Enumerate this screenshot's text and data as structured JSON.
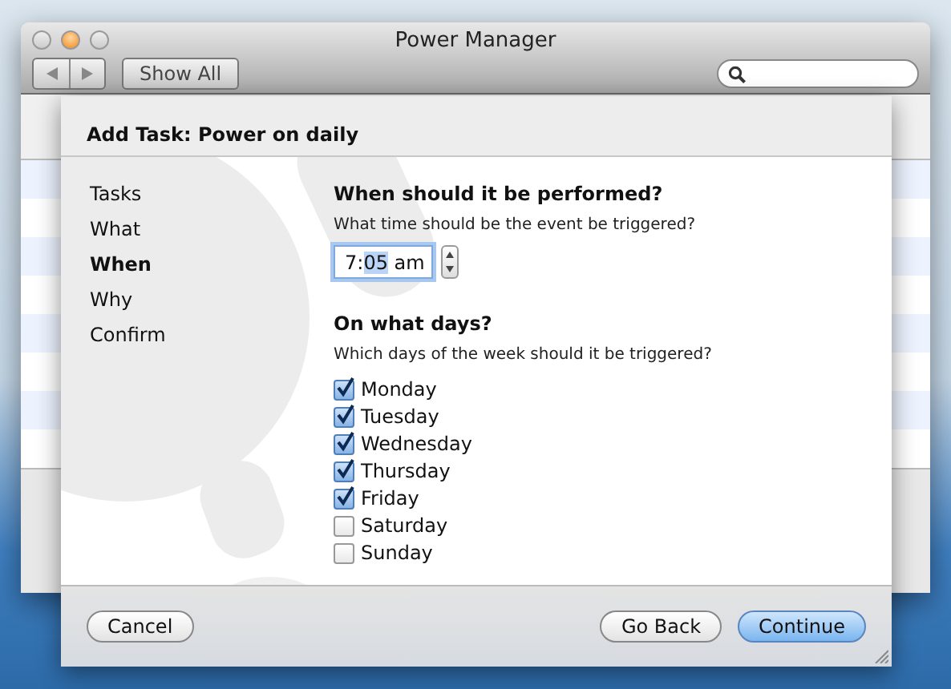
{
  "window": {
    "title": "Power Manager"
  },
  "toolbar": {
    "show_all": "Show All"
  },
  "sheet": {
    "title": "Add Task: Power on daily",
    "steps": [
      {
        "label": "Tasks",
        "selected": false
      },
      {
        "label": "What",
        "selected": false
      },
      {
        "label": "When",
        "selected": true
      },
      {
        "label": "Why",
        "selected": false
      },
      {
        "label": "Confirm",
        "selected": false
      }
    ],
    "time_section": {
      "heading": "When should it be performed?",
      "prompt": "What time should be the event be triggered?",
      "time_field": {
        "segments": [
          {
            "text": "7",
            "selected": false
          },
          {
            "text": ":",
            "selected": false
          },
          {
            "text": "05",
            "selected": true
          },
          {
            "text": " am",
            "selected": false
          }
        ]
      }
    },
    "days_section": {
      "heading": "On what days?",
      "prompt": "Which days of the week should it be triggered?",
      "days": [
        {
          "label": "Monday",
          "checked": true
        },
        {
          "label": "Tuesday",
          "checked": true
        },
        {
          "label": "Wednesday",
          "checked": true
        },
        {
          "label": "Thursday",
          "checked": true
        },
        {
          "label": "Friday",
          "checked": true
        },
        {
          "label": "Saturday",
          "checked": false
        },
        {
          "label": "Sunday",
          "checked": false
        }
      ]
    },
    "left_buttons": [
      {
        "label": "Cancel",
        "default": false
      }
    ],
    "right_buttons": [
      {
        "label": "Go Back",
        "default": false
      },
      {
        "label": "Continue",
        "default": true
      }
    ]
  }
}
